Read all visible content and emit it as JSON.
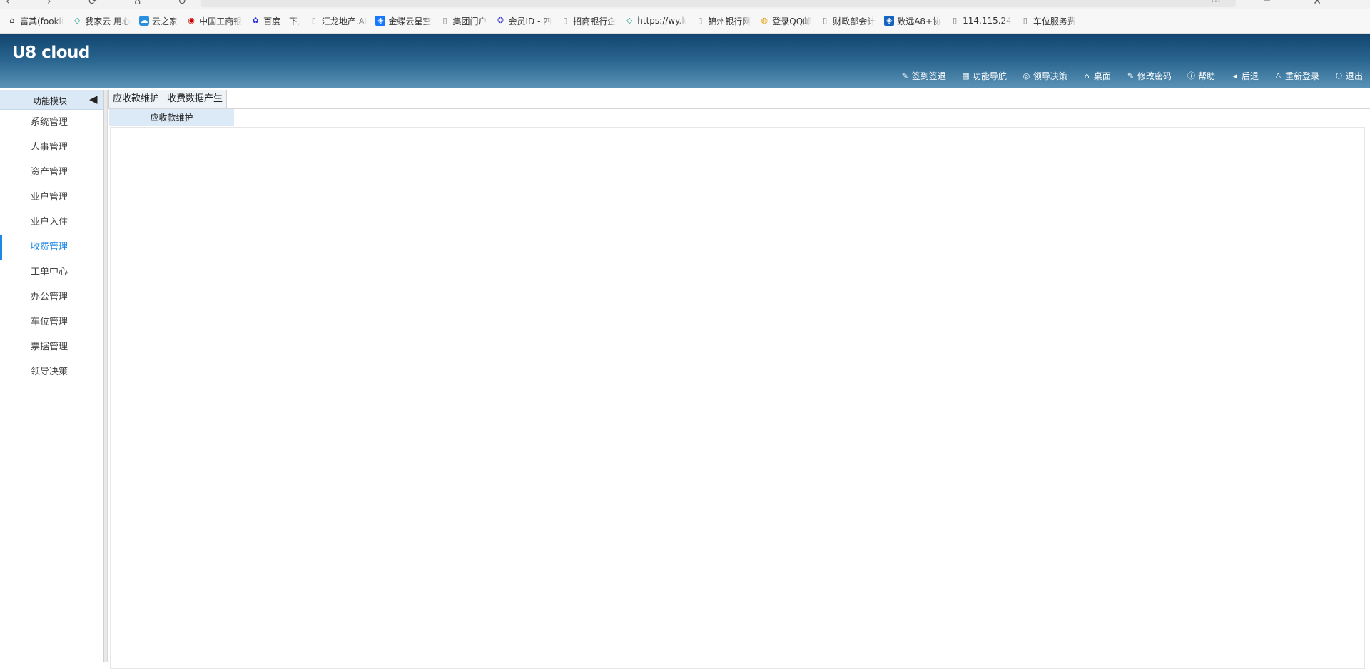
{
  "bookmarks": [
    {
      "icon": "house-icon",
      "label": "富其(fookii"
    },
    {
      "icon": "diamond-icon",
      "label": "我家云 用心"
    },
    {
      "icon": "cloud-icon",
      "label": "云之家"
    },
    {
      "icon": "icbc-icon",
      "label": "中国工商银"
    },
    {
      "icon": "paw-icon",
      "label": "百度一下,"
    },
    {
      "icon": "page-icon",
      "label": "汇龙地产.AI"
    },
    {
      "icon": "square-icon",
      "label": "金蝶云星空"
    },
    {
      "icon": "page-icon",
      "label": "集团门户"
    },
    {
      "icon": "logo-icon",
      "label": "会员ID - 四"
    },
    {
      "icon": "page-icon",
      "label": "招商银行企"
    },
    {
      "icon": "diamond-icon",
      "label": "https://wy.k"
    },
    {
      "icon": "page-icon",
      "label": "锦州银行网"
    },
    {
      "icon": "chrome-icon",
      "label": "登录QQ邮"
    },
    {
      "icon": "page-icon",
      "label": "财政部会计"
    },
    {
      "icon": "square-icon",
      "label": "致远A8+协"
    },
    {
      "icon": "page-icon",
      "label": "114.115.24"
    },
    {
      "icon": "page-icon",
      "label": "车位服务费"
    }
  ],
  "header": {
    "logo": "U8 cloud",
    "menu": [
      {
        "icon": "edit-icon",
        "label": "签到签退"
      },
      {
        "icon": "grid-icon",
        "label": "功能导航"
      },
      {
        "icon": "decision-icon",
        "label": "领导决策"
      },
      {
        "icon": "home-icon",
        "label": "桌面"
      },
      {
        "icon": "edit-icon",
        "label": "修改密码"
      },
      {
        "icon": "info-icon",
        "label": "帮助"
      },
      {
        "icon": "back-icon",
        "label": "后退"
      },
      {
        "icon": "user-icon",
        "label": "重新登录"
      },
      {
        "icon": "power-icon",
        "label": "退出"
      }
    ]
  },
  "sidebar": {
    "title": "功能模块",
    "items": [
      {
        "label": "系统管理",
        "active": false
      },
      {
        "label": "人事管理",
        "active": false
      },
      {
        "label": "资产管理",
        "active": false
      },
      {
        "label": "业户管理",
        "active": false
      },
      {
        "label": "业户入住",
        "active": false
      },
      {
        "label": "收费管理",
        "active": true
      },
      {
        "label": "工单中心",
        "active": false
      },
      {
        "label": "办公管理",
        "active": false
      },
      {
        "label": "车位管理",
        "active": false
      },
      {
        "label": "票据管理",
        "active": false
      },
      {
        "label": "领导决策",
        "active": false
      }
    ]
  },
  "main": {
    "tabs": [
      {
        "label": "应收款维护"
      },
      {
        "label": "收费数据产生"
      }
    ],
    "subtab": "应收款维护"
  }
}
